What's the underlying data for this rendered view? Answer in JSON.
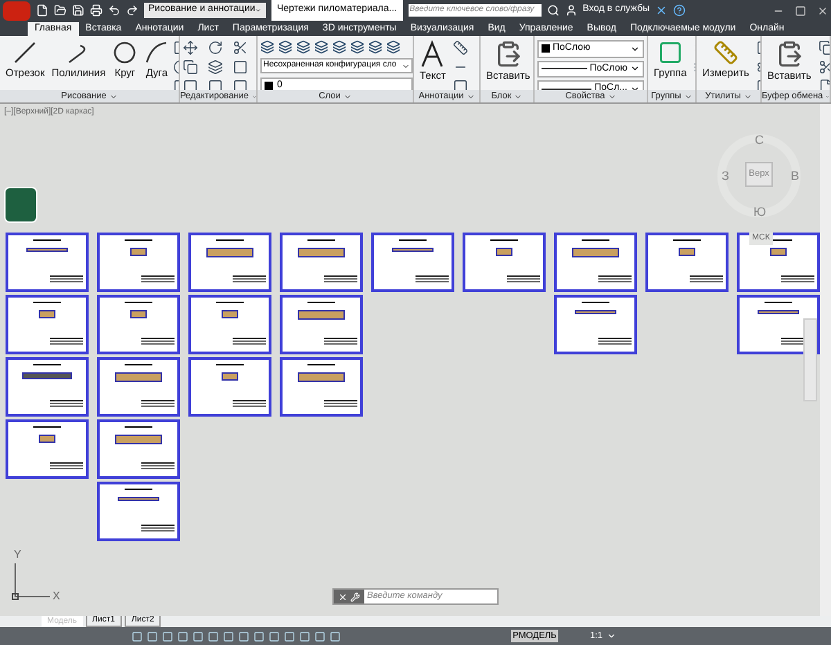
{
  "title_bar": {
    "workspace": "Рисование и аннотации",
    "document_title": "Чертежи пиломатериала...",
    "search": {
      "placeholder": "Введите ключевое слово/фразу"
    },
    "sign_in": "Вход в службы"
  },
  "tabs": [
    {
      "label": "Главная",
      "selected": true
    },
    {
      "label": "Вставка",
      "selected": false
    },
    {
      "label": "Аннотации",
      "selected": false
    },
    {
      "label": "Лист",
      "selected": false
    },
    {
      "label": "Параметризация",
      "selected": false
    },
    {
      "label": "3D инструменты",
      "selected": false
    },
    {
      "label": "Визуализация",
      "selected": false
    },
    {
      "label": "Вид",
      "selected": false
    },
    {
      "label": "Управление",
      "selected": false
    },
    {
      "label": "Вывод",
      "selected": false
    },
    {
      "label": "Подключаемые модули",
      "selected": false
    },
    {
      "label": "Онлайн",
      "selected": false
    }
  ],
  "ribbon_panels": [
    {
      "kind": "draw",
      "title": "Рисование",
      "tools": [
        "Отрезок",
        "Полилиния",
        "Круг",
        "Дуга"
      ]
    },
    {
      "kind": "modify",
      "title": "Редактирование"
    },
    {
      "kind": "layers",
      "title": "Слои",
      "tools": [
        "Несохраненная конфигурация сло",
        "0"
      ]
    },
    {
      "kind": "annotate",
      "title": "Аннотации",
      "tools": [
        "Текст"
      ]
    },
    {
      "kind": "block",
      "title": "Блок",
      "tools": [
        "Вставить"
      ]
    },
    {
      "kind": "props",
      "title": "Свойства",
      "tools": [
        "ПоСлою",
        "ПоСлою",
        "ПоСл..."
      ]
    },
    {
      "kind": "groups",
      "title": "Группы",
      "tools": [
        "Группа"
      ]
    },
    {
      "kind": "utils",
      "title": "Утилиты",
      "tools": [
        "Измерить"
      ]
    },
    {
      "kind": "clipboard",
      "title": "Буфер обмена",
      "tools": [
        "Вставить"
      ]
    }
  ],
  "viewport": {
    "label": "[–][Верхний][2D каркас]",
    "viewcube": {
      "north": "С",
      "west": "З",
      "east": "В",
      "south": "Ю",
      "face": "Верх",
      "ucs": "МСК"
    },
    "axes": {
      "y": "Y",
      "x": "X"
    },
    "sheet_columns": [
      {
        "sheets": [
          {
            "kind": "thin"
          },
          {
            "kind": "small"
          },
          {
            "kind": "rail"
          },
          {
            "kind": "small"
          }
        ]
      },
      {
        "sheets": [
          {
            "kind": "small"
          },
          {
            "kind": "small"
          },
          {
            "kind": "wide"
          },
          {
            "kind": "wide"
          },
          {
            "kind": "thin"
          }
        ]
      },
      {
        "sheets": [
          {
            "kind": "wide"
          },
          {
            "kind": "small"
          },
          {
            "kind": "small"
          }
        ]
      },
      {
        "sheets": [
          {
            "kind": "wide"
          },
          {
            "kind": "wide"
          },
          {
            "kind": "wide"
          }
        ]
      },
      {
        "sheets": [
          {
            "kind": "thin"
          }
        ]
      },
      {
        "sheets": [
          {
            "kind": "small"
          }
        ]
      },
      {
        "sheets": [
          {
            "kind": "wide"
          },
          {
            "kind": "thin"
          }
        ]
      },
      {
        "sheets": [
          {
            "kind": "small"
          }
        ]
      },
      {
        "sheets": [
          {
            "kind": "small"
          },
          {
            "kind": "thin"
          }
        ]
      }
    ]
  },
  "command_line": {
    "placeholder": "Введите команду"
  },
  "layout_tabs": [
    {
      "label": "Модель",
      "selected": true
    },
    {
      "label": "Лист1",
      "selected": false
    },
    {
      "label": "Лист2",
      "selected": false
    }
  ],
  "status_bar": {
    "space": "РМОДЕЛЬ",
    "scale": "1:1"
  }
}
